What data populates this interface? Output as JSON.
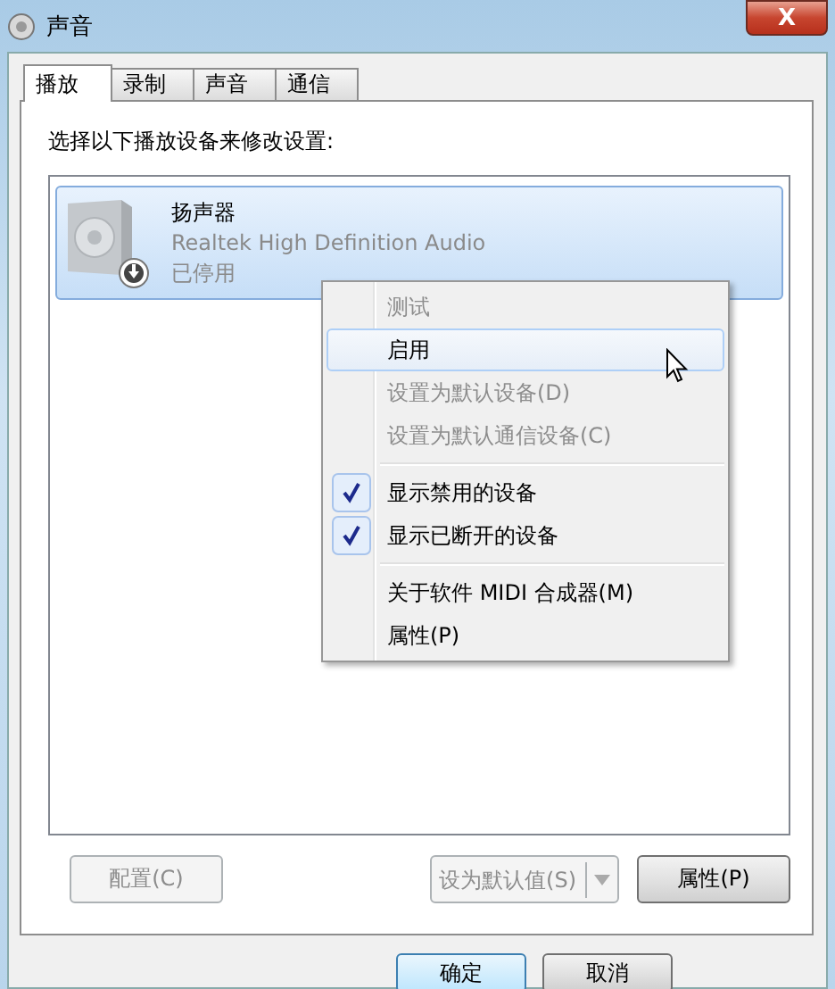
{
  "window": {
    "title": "声音",
    "close_label": "X"
  },
  "tabs": [
    {
      "label": "播放",
      "selected": true
    },
    {
      "label": "录制",
      "selected": false
    },
    {
      "label": "声音",
      "selected": false
    },
    {
      "label": "通信",
      "selected": false
    }
  ],
  "instruction": "选择以下播放设备来修改设置:",
  "devices": [
    {
      "name": "扬声器",
      "driver": "Realtek High Definition Audio",
      "status": "已停用",
      "selected": true,
      "disabled": true
    }
  ],
  "context_menu": {
    "groups": [
      [
        {
          "label": "测试",
          "disabled": true,
          "highlighted": false
        },
        {
          "label": "启用",
          "disabled": false,
          "highlighted": true
        },
        {
          "label": "设置为默认设备(D)",
          "disabled": true,
          "highlighted": false
        },
        {
          "label": "设置为默认通信设备(C)",
          "disabled": true,
          "highlighted": false
        }
      ],
      [
        {
          "label": "显示禁用的设备",
          "disabled": false,
          "highlighted": false,
          "checked": true
        },
        {
          "label": "显示已断开的设备",
          "disabled": false,
          "highlighted": false,
          "checked": true
        }
      ],
      [
        {
          "label": "关于软件 MIDI 合成器(M)",
          "disabled": false,
          "highlighted": false
        },
        {
          "label": "属性(P)",
          "disabled": false,
          "highlighted": false
        }
      ]
    ]
  },
  "panel_buttons": {
    "configure": {
      "label": "配置(C)",
      "disabled": true
    },
    "set_default": {
      "label": "设为默认值(S)",
      "disabled": true
    },
    "properties": {
      "label": "属性(P)",
      "disabled": false
    }
  },
  "dialog_buttons": [
    {
      "label": "确定",
      "default": true
    },
    {
      "label": "取消",
      "default": false
    }
  ]
}
